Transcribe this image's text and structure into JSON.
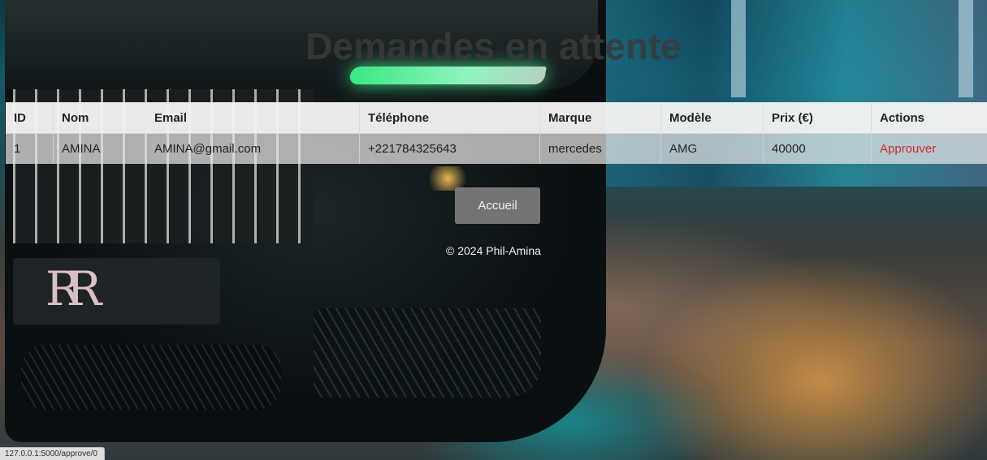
{
  "page": {
    "title": "Demandes en attente"
  },
  "table": {
    "headers": [
      "ID",
      "Nom",
      "Email",
      "Téléphone",
      "Marque",
      "Modèle",
      "Prix (€)",
      "Actions"
    ],
    "rows": [
      {
        "id": "1",
        "nom": "AMINA",
        "email": "AMINA@gmail.com",
        "telephone": "+221784325643",
        "marque": "mercedes",
        "modele": "AMG",
        "prix": "40000",
        "action": "Approuver"
      }
    ]
  },
  "buttons": {
    "home_label": "Accueil"
  },
  "footer": {
    "text": "© 2024 Phil-Amina"
  },
  "status_bar": {
    "url": "127.0.0.1:5000/approve/0"
  },
  "colors": {
    "action_link": "#d3282c",
    "button_bg": "#7d7d7d",
    "header_row_bg": "#f2f2f2"
  }
}
